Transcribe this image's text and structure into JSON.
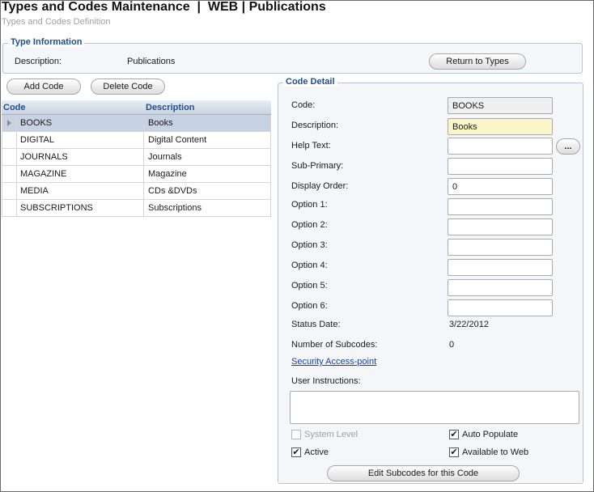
{
  "header": {
    "title": "Types and Codes Maintenance  |  WEB | Publications",
    "subtitle": "Types and Codes Definition"
  },
  "type_information": {
    "legend": "Type Information",
    "description_label": "Description:",
    "description_value": "Publications",
    "return_button": "Return to Types"
  },
  "toolbar": {
    "add_code": "Add Code",
    "delete_code": "Delete Code"
  },
  "grid": {
    "columns": [
      "Code",
      "Description"
    ],
    "rows": [
      {
        "code": "BOOKS",
        "description": "Books"
      },
      {
        "code": "DIGITAL",
        "description": "Digital Content"
      },
      {
        "code": "JOURNALS",
        "description": "Journals"
      },
      {
        "code": "MAGAZINE",
        "description": "Magazine"
      },
      {
        "code": "MEDIA",
        "description": "CDs &DVDs"
      },
      {
        "code": "SUBSCRIPTIONS",
        "description": "Subscriptions"
      }
    ],
    "selected_index": 0
  },
  "code_detail": {
    "legend": "Code Detail",
    "labels": {
      "code": "Code:",
      "description": "Description:",
      "help_text": "Help Text:",
      "sub_primary": "Sub-Primary:",
      "display_order": "Display Order:",
      "option1": "Option 1:",
      "option2": "Option 2:",
      "option3": "Option 3:",
      "option4": "Option 4:",
      "option5": "Option 5:",
      "option6": "Option 6:",
      "status_date": "Status Date:",
      "number_of_subcodes": "Number of Subcodes:",
      "user_instructions": "User Instructions:"
    },
    "values": {
      "code": "BOOKS",
      "description": "Books",
      "help_text": "",
      "sub_primary": "",
      "display_order": "0",
      "option1": "",
      "option2": "",
      "option3": "",
      "option4": "",
      "option5": "",
      "option6": "",
      "status_date": "3/22/2012",
      "number_of_subcodes": "0",
      "user_instructions": ""
    },
    "help_button": "...",
    "security_link": "Security Access-point",
    "checkboxes": {
      "system_level": {
        "label": "System Level",
        "checked": false,
        "enabled": false
      },
      "auto_populate": {
        "label": "Auto Populate",
        "checked": true,
        "enabled": true
      },
      "active": {
        "label": "Active",
        "checked": true,
        "enabled": true
      },
      "available_to_web": {
        "label": "Available to Web",
        "checked": true,
        "enabled": true
      }
    },
    "check_mark": "✔",
    "edit_subcodes_button": "Edit Subcodes for this Code"
  }
}
